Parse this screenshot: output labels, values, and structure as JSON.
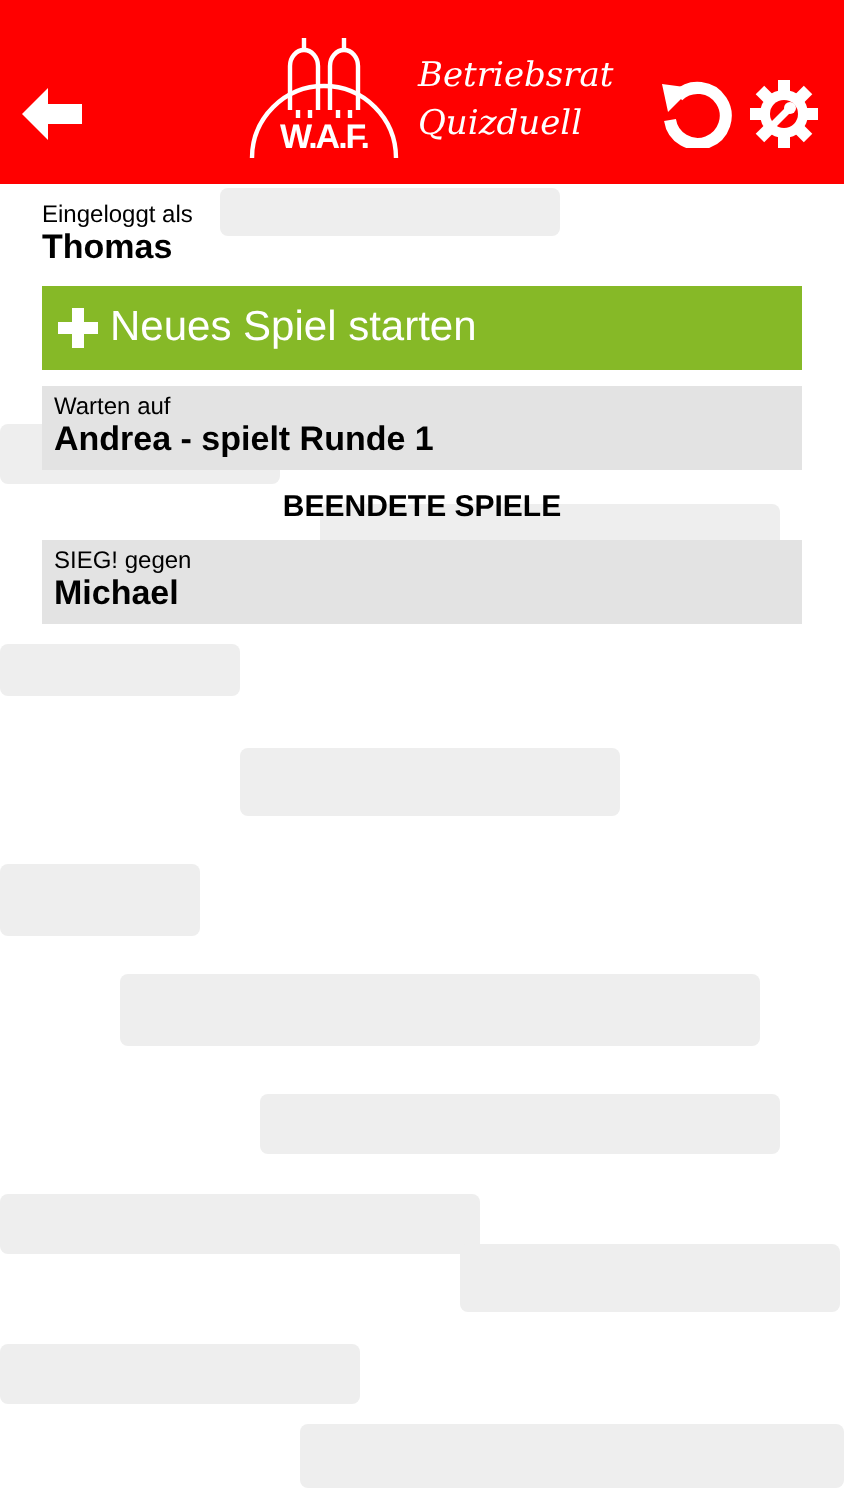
{
  "header": {
    "logo_mark": "W.A.F.",
    "logo_title": [
      "Betriebsrat",
      "Quizduell"
    ]
  },
  "user": {
    "label": "Eingeloggt als",
    "name": "Thomas"
  },
  "new_game_button": {
    "label": "Neues Spiel starten"
  },
  "open_games": [
    {
      "caption": "Warten auf",
      "title": "Andrea - spielt Runde 1"
    }
  ],
  "finished_heading": "BEENDETE SPIELE",
  "finished_games": [
    {
      "caption": "SIEG! gegen",
      "title": "Michael"
    }
  ]
}
